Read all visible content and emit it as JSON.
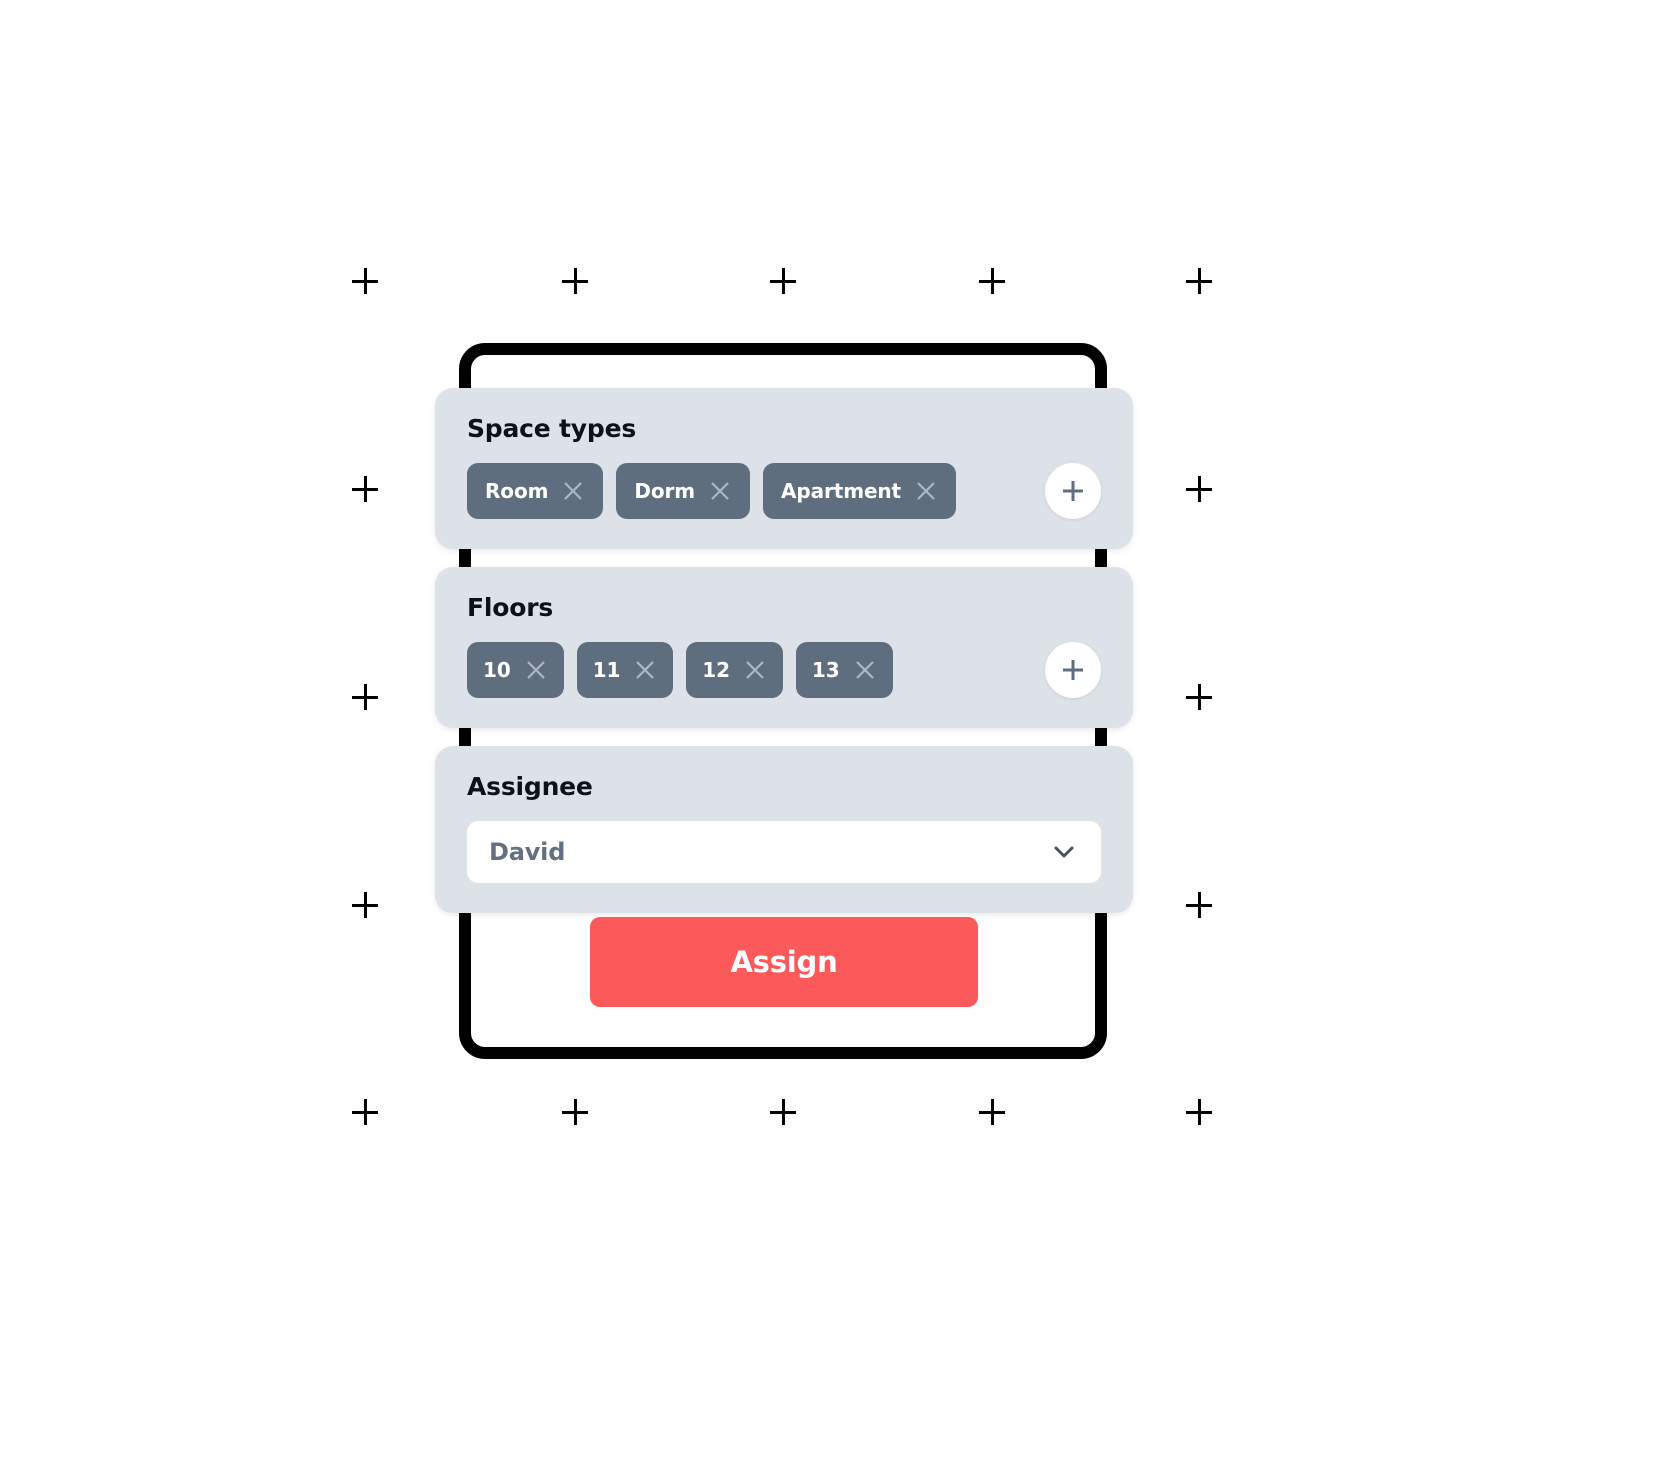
{
  "card": {
    "accent_color": "#fc5a5a",
    "panel_color": "#dde2e9",
    "chip_color": "#5f6e7e",
    "border_color": "#000000"
  },
  "sections": {
    "space_types": {
      "title": "Space types",
      "add_icon": "plus-icon",
      "chips": [
        {
          "label": "Room",
          "remove_icon": "close-icon"
        },
        {
          "label": "Dorm",
          "remove_icon": "close-icon"
        },
        {
          "label": "Apartment",
          "remove_icon": "close-icon"
        }
      ]
    },
    "floors": {
      "title": "Floors",
      "add_icon": "plus-icon",
      "chips": [
        {
          "label": "10",
          "remove_icon": "close-icon"
        },
        {
          "label": "11",
          "remove_icon": "close-icon"
        },
        {
          "label": "12",
          "remove_icon": "close-icon"
        },
        {
          "label": "13",
          "remove_icon": "close-icon"
        }
      ]
    },
    "assignee": {
      "title": "Assignee",
      "selected": "David",
      "chevron_icon": "chevron-down-icon"
    }
  },
  "submit": {
    "label": "Assign"
  },
  "background": {
    "marker_icon": "crosshair-marker",
    "columns": [
      365,
      575,
      783,
      992,
      1199
    ],
    "rows": [
      281,
      489,
      697,
      905,
      1112
    ]
  }
}
